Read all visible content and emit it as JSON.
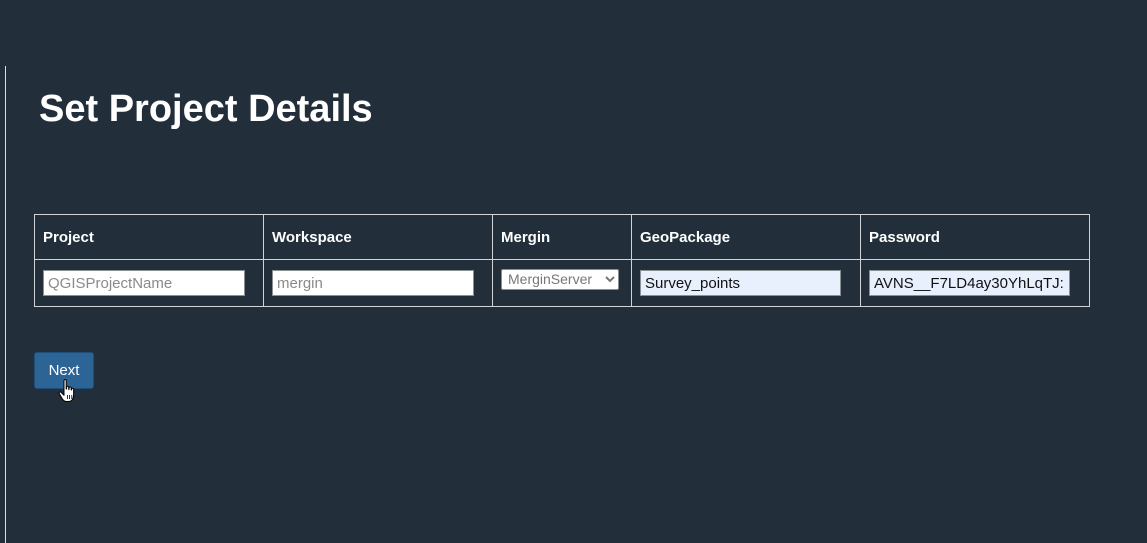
{
  "page": {
    "title": "Set Project Details"
  },
  "table": {
    "headers": {
      "project": "Project",
      "workspace": "Workspace",
      "mergin": "Mergin",
      "geopackage": "GeoPackage",
      "password": "Password"
    },
    "project": {
      "value": "",
      "placeholder": "QGISProjectName"
    },
    "workspace": {
      "value": "",
      "placeholder": "mergin"
    },
    "mergin": {
      "selected": "MerginServer"
    },
    "geopackage": {
      "value": "Survey_points"
    },
    "password": {
      "value": "AVNS__F7LD4ay30YhLqTJ:"
    }
  },
  "actions": {
    "next_label": "Next"
  },
  "icons": {
    "cursor": "hand-pointer-icon"
  },
  "colors": {
    "background": "#222f3b",
    "button": "#2c6496",
    "autofill": "#e8f0fe"
  }
}
